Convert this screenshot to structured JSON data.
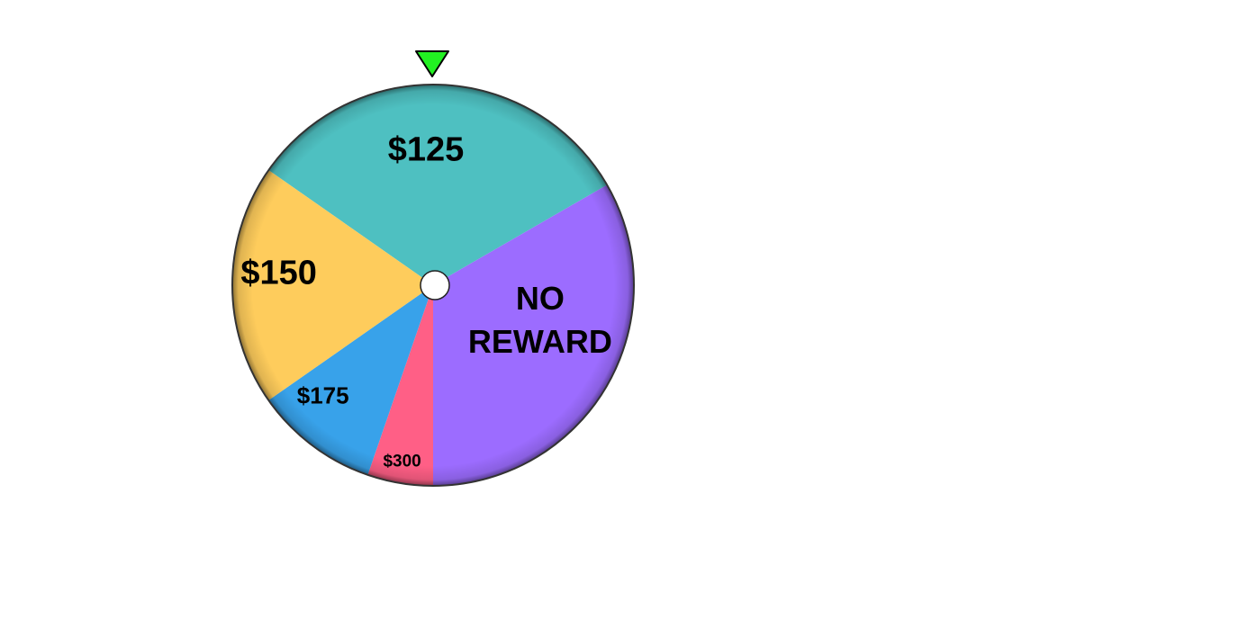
{
  "wheel": {
    "segments": [
      {
        "label": "$125",
        "lines": [
          "$125"
        ],
        "start_deg": -55,
        "end_deg": 60,
        "color": "#4EC0C1"
      },
      {
        "label": "NO REWARD",
        "lines": [
          "NO",
          "REWARD"
        ],
        "start_deg": 60,
        "end_deg": 180,
        "color": "#9C6CFF"
      },
      {
        "label": "$300",
        "lines": [
          "$300"
        ],
        "start_deg": 180,
        "end_deg": 199,
        "color": "#FF5F86"
      },
      {
        "label": "$175",
        "lines": [
          "$175"
        ],
        "start_deg": 199,
        "end_deg": 235,
        "color": "#38A2EA"
      },
      {
        "label": "$150",
        "lines": [
          "$150"
        ],
        "start_deg": 235,
        "end_deg": 305,
        "color": "#FECC5C"
      }
    ],
    "pointer_color": "#22F022",
    "rim_color": "#333333",
    "hub_color": "#FFFFFF"
  }
}
